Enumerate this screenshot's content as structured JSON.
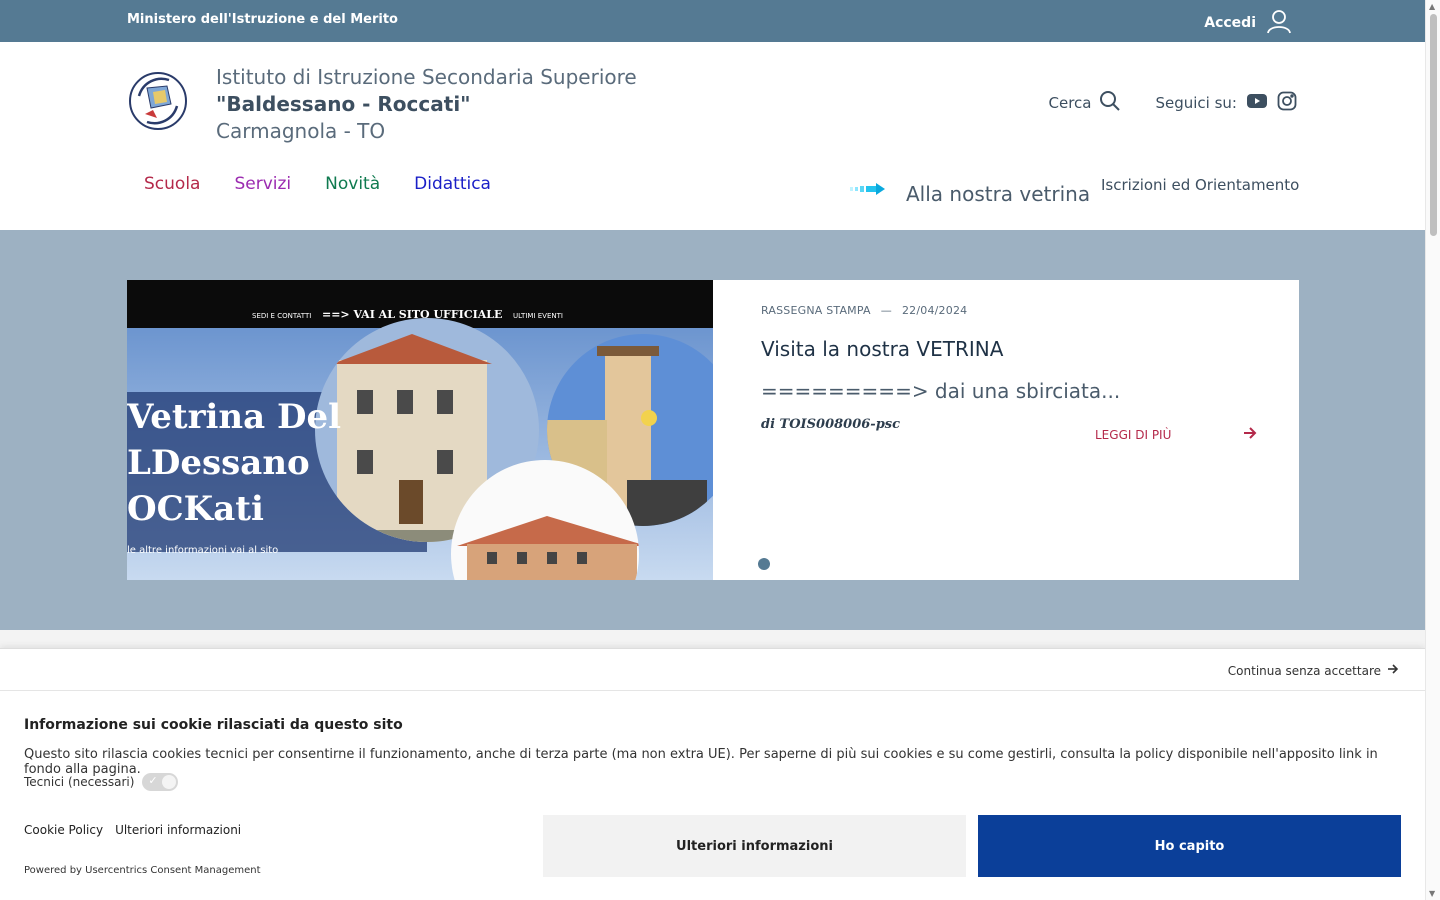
{
  "topbar": {
    "ministry": "Ministero dell'Istruzione e del Merito",
    "login_label": "Accedi"
  },
  "school": {
    "line1": "Istituto di Istruzione Secondaria Superiore",
    "line2": "\"Baldessano - Roccati\"",
    "line3": "Carmagnola - TO"
  },
  "tools": {
    "search_label": "Cerca",
    "follow_label": "Seguici su:"
  },
  "nav": [
    {
      "label": "Scuola",
      "color": "#b4294a"
    },
    {
      "label": "Servizi",
      "color": "#9b2bb0"
    },
    {
      "label": "Novità",
      "color": "#0f7a4f"
    },
    {
      "label": "Didattica",
      "color": "#1a1fc7"
    }
  ],
  "vetrina_label": "Alla nostra vetrina",
  "iscrizioni_label": "Iscrizioni ed Orientamento",
  "hero": {
    "image_topbar": {
      "left": "SEDI E CONTATTI",
      "center": "==> VAI AL SITO UFFICIALE",
      "right": "ULTIMI EVENTI"
    },
    "image_title_lines": [
      "Vetrina Del",
      "LDessano",
      "OCKati"
    ],
    "image_caption": "le altre informazioni vai al sito",
    "category": "RASSEGNA STAMPA",
    "separator": "—",
    "date": "22/04/2024",
    "title": "Visita la nostra VETRINA",
    "subtitle": "=========> dai una sbirciata...",
    "author": "di TOIS008006-psc",
    "more_label": "LEGGI DI PIÙ"
  },
  "cookie": {
    "continue_label": "Continua senza accettare",
    "title": "Informazione sui cookie rilasciati da questo sito",
    "description": "Questo sito rilascia cookies tecnici per consentirne il funzionamento, anche di terza parte (ma non extra UE). Per saperne di più sui cookies e su come gestirli, consulta la policy disponibile nell'apposito link in fondo alla pagina.",
    "tech_label": "Tecnici (necessari)",
    "policy_link": "Cookie Policy",
    "info_link": "Ulteriori informazioni",
    "powered": "Powered by Usercentrics Consent Management",
    "btn_more": "Ulteriori informazioni",
    "btn_ok": "Ho capito"
  },
  "colors": {
    "topbar": "#557a93",
    "accent_red": "#b4294a",
    "primary_btn": "#0b3f99"
  }
}
